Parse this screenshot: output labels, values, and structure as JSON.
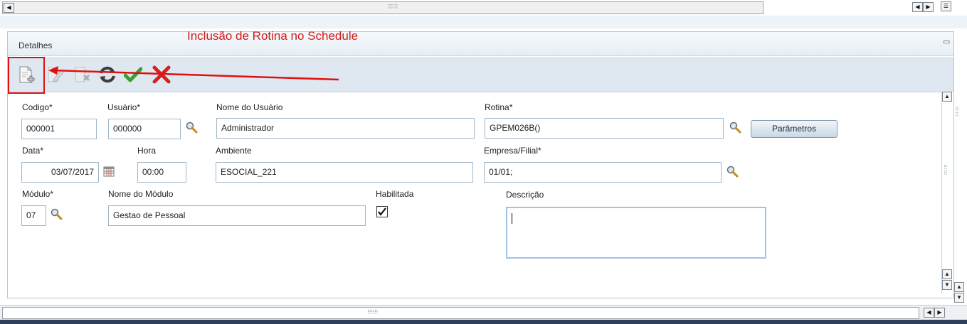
{
  "annotation": {
    "text": "Inclusão de Rotina no Schedule",
    "color": "#d11a1a"
  },
  "panel": {
    "title": "Detalhes"
  },
  "toolbar": {
    "tools": [
      {
        "name": "new-record-icon",
        "enabled": true
      },
      {
        "name": "edit-record-icon",
        "enabled": false
      },
      {
        "name": "delete-record-icon",
        "enabled": false
      },
      {
        "name": "refresh-icon",
        "enabled": true
      },
      {
        "name": "confirm-icon",
        "enabled": true
      },
      {
        "name": "cancel-icon",
        "enabled": true
      }
    ]
  },
  "form": {
    "codigo": {
      "label": "Codigo*",
      "value": "000001"
    },
    "usuario": {
      "label": "Usuário*",
      "value": "000000"
    },
    "nome_usuario": {
      "label": "Nome do Usuário",
      "value": "Administrador"
    },
    "rotina": {
      "label": "Rotina*",
      "value": "GPEM026B()"
    },
    "parametros_button": "Parâmetros",
    "data": {
      "label": "Data*",
      "value": "03/07/2017"
    },
    "hora": {
      "label": "Hora",
      "value": "00:00"
    },
    "ambiente": {
      "label": "Ambiente",
      "value": "ESOCIAL_221"
    },
    "empresa_filial": {
      "label": "Empresa/Filial*",
      "value": "01/01;"
    },
    "modulo": {
      "label": "Módulo*",
      "value": "07"
    },
    "nome_modulo": {
      "label": "Nome do Módulo",
      "value": "Gestao de Pessoal"
    },
    "habilitada": {
      "label": "Habilitada",
      "checked": true
    },
    "descricao": {
      "label": "Descrição",
      "value": ""
    }
  },
  "colors": {
    "accent_red": "#e01010",
    "confirm_green": "#3aa035",
    "panel_border": "#b7c8d6"
  }
}
